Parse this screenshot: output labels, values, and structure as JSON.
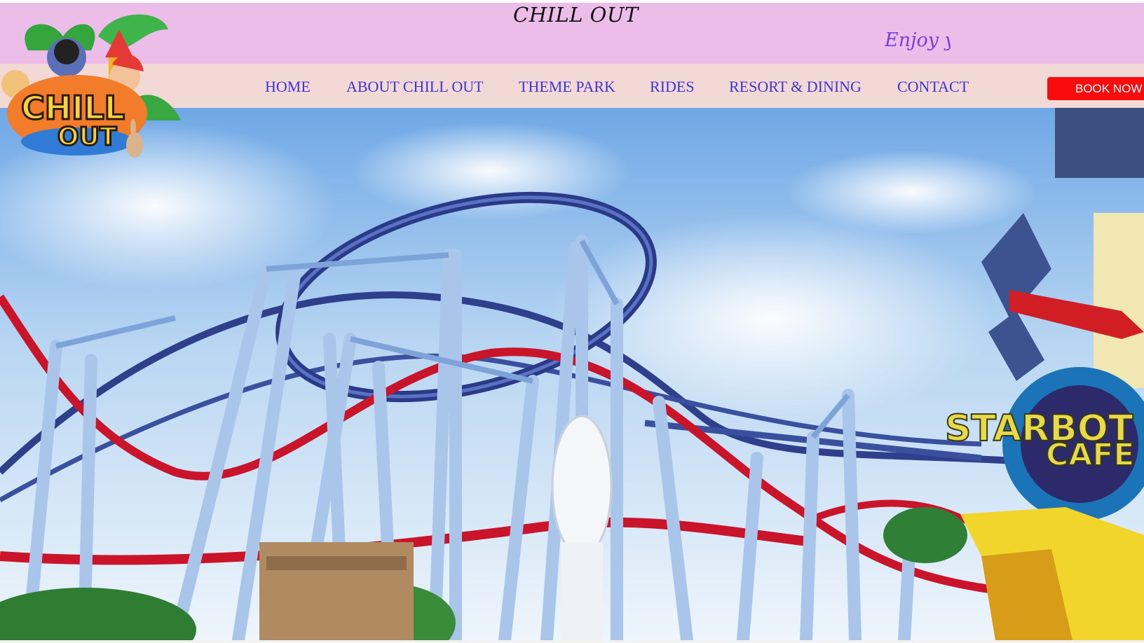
{
  "header": {
    "title": "CHILL OUT",
    "tagline": "Enjoy you"
  },
  "logo": {
    "line1": "CHILL",
    "line2": "OUT"
  },
  "nav": {
    "items": [
      {
        "label": "HOME"
      },
      {
        "label": "ABOUT CHILL OUT"
      },
      {
        "label": "THEME PARK"
      },
      {
        "label": "RIDES"
      },
      {
        "label": "RESORT & DINING"
      },
      {
        "label": "CONTACT"
      }
    ],
    "book_label": "BOOK NOW"
  },
  "hero": {
    "sign_line1": "STARBOT",
    "sign_line2": "CAFE"
  },
  "colors": {
    "banner": "#ebbde8",
    "nav_bg": "#f3d9d5",
    "nav_text": "#3f35d6",
    "book_button": "#fb0c0c"
  }
}
